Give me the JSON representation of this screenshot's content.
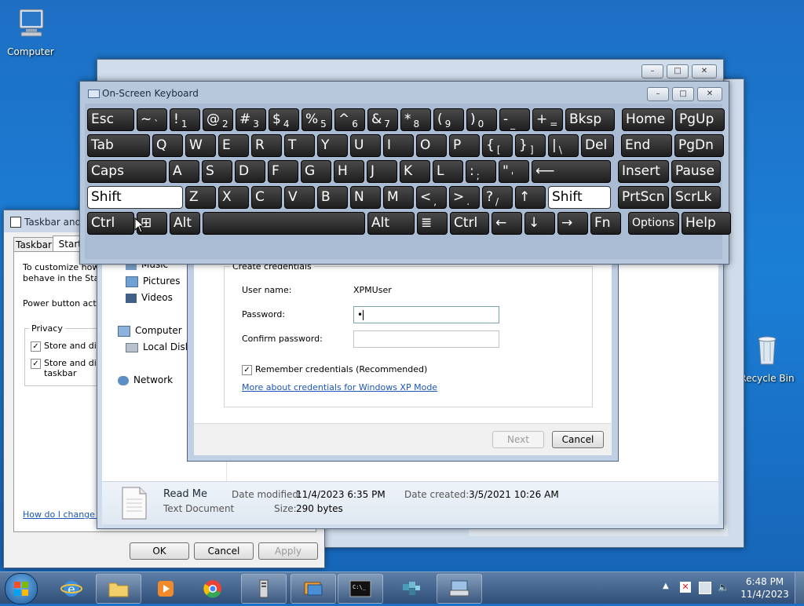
{
  "desktop": {
    "computer_label": "Computer",
    "recycle_label": "Recycle Bin"
  },
  "osk": {
    "title": "On-Screen Keyboard",
    "rows": [
      [
        [
          "Esc",
          ""
        ],
        [
          "~",
          "`"
        ],
        [
          "!",
          "1"
        ],
        [
          "@",
          "2"
        ],
        [
          "#",
          "3"
        ],
        [
          "$",
          "4"
        ],
        [
          "%",
          "5"
        ],
        [
          "^",
          "6"
        ],
        [
          "&",
          "7"
        ],
        [
          "*",
          "8"
        ],
        [
          "(",
          "9"
        ],
        [
          ")",
          "0"
        ],
        [
          "-",
          "_"
        ],
        [
          "+",
          "="
        ],
        [
          "Bksp",
          ""
        ],
        [
          "Home",
          ""
        ],
        [
          "PgUp",
          ""
        ]
      ],
      [
        [
          "Tab",
          ""
        ],
        [
          "Q",
          ""
        ],
        [
          "W",
          ""
        ],
        [
          "E",
          ""
        ],
        [
          "R",
          ""
        ],
        [
          "T",
          ""
        ],
        [
          "Y",
          ""
        ],
        [
          "U",
          ""
        ],
        [
          "I",
          ""
        ],
        [
          "O",
          ""
        ],
        [
          "P",
          ""
        ],
        [
          "{",
          "["
        ],
        [
          "}",
          "]"
        ],
        [
          "|",
          "\\"
        ],
        [
          "Del",
          ""
        ],
        [
          "End",
          ""
        ],
        [
          "PgDn",
          ""
        ]
      ],
      [
        [
          "Caps",
          ""
        ],
        [
          "A",
          ""
        ],
        [
          "S",
          ""
        ],
        [
          "D",
          ""
        ],
        [
          "F",
          ""
        ],
        [
          "G",
          ""
        ],
        [
          "H",
          ""
        ],
        [
          "J",
          ""
        ],
        [
          "K",
          ""
        ],
        [
          "L",
          ""
        ],
        [
          ":",
          ";"
        ],
        [
          "\"",
          "'"
        ],
        [
          "⟵",
          ""
        ],
        [
          "Insert",
          ""
        ],
        [
          "Pause",
          ""
        ]
      ],
      [
        [
          "Shift",
          ""
        ],
        [
          "Z",
          ""
        ],
        [
          "X",
          ""
        ],
        [
          "C",
          ""
        ],
        [
          "V",
          ""
        ],
        [
          "B",
          ""
        ],
        [
          "N",
          ""
        ],
        [
          "M",
          ""
        ],
        [
          "<",
          ","
        ],
        [
          ">",
          "."
        ],
        [
          "?",
          "/"
        ],
        [
          "↑",
          ""
        ],
        [
          "Shift",
          ""
        ],
        [
          "PrtScn",
          ""
        ],
        [
          "ScrLk",
          ""
        ]
      ],
      [
        [
          "Ctrl",
          ""
        ],
        [
          "⊞",
          ""
        ],
        [
          "Alt",
          ""
        ],
        [
          "",
          ""
        ],
        [
          "Alt",
          ""
        ],
        [
          "≣",
          ""
        ],
        [
          "Ctrl",
          ""
        ],
        [
          "←",
          ""
        ],
        [
          "↓",
          ""
        ],
        [
          "→",
          ""
        ],
        [
          "Fn",
          ""
        ],
        [
          "Options",
          ""
        ],
        [
          "Help",
          ""
        ]
      ]
    ]
  },
  "taskbar_props": {
    "title": "Taskbar and S",
    "tab_taskbar": "Taskbar",
    "tab_start": "Start I",
    "desc_line1": "To customize how li",
    "desc_line2": "behave in the Start",
    "power_label": "Power button actio",
    "privacy_label": "Privacy",
    "check1": "Store and disp",
    "check2a": "Store and disp",
    "check2b": "taskbar",
    "help_link": "How do I change th",
    "ok": "OK",
    "cancel": "Cancel",
    "apply": "Apply"
  },
  "explorer": {
    "nav": [
      "Music",
      "Pictures",
      "Videos",
      "Computer",
      "Local Disk",
      "Network"
    ],
    "details": {
      "name": "Read Me",
      "type": "Text Document",
      "modified_label": "Date modified:",
      "modified_value": "11/4/2023 6:35 PM",
      "created_label": "Date created:",
      "created_value": "3/5/2021 10:26 AM",
      "size_label": "Size:",
      "size_value": "290 bytes"
    }
  },
  "dialog": {
    "group_title": "Create credentials",
    "user_label": "User name:",
    "user_value": "XPMUser",
    "password_label": "Password:",
    "password_value": "•",
    "confirm_label": "Confirm password:",
    "remember_label": "Remember credentials (Recommended)",
    "more_link": "More about credentials for Windows XP Mode",
    "next": "Next",
    "cancel": "Cancel"
  },
  "clock": {
    "time": "6:48 PM",
    "date": "11/4/2023"
  }
}
